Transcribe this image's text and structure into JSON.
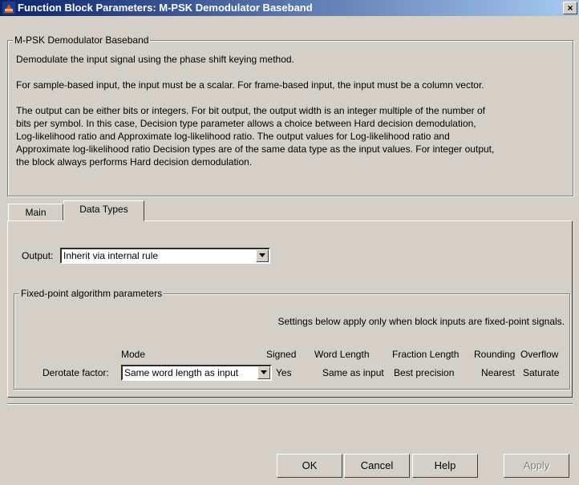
{
  "window": {
    "title": "Function Block Parameters: M-PSK Demodulator Baseband",
    "close_label": "×"
  },
  "block": {
    "group_title": "M-PSK Demodulator Baseband",
    "desc1": "Demodulate the input signal using the phase shift keying method.",
    "desc2": "For sample-based input, the input must be a scalar. For frame-based input, the input must be a column vector.",
    "desc3_lines": [
      "The output can be either bits or integers. For bit output, the output width is an integer multiple of the number of",
      "bits per symbol. In this case, Decision type parameter allows a choice between Hard decision demodulation,",
      "Log-likelihood ratio and Approximate log-likelihood ratio. The output values for Log-likelihood ratio and",
      "Approximate log-likelihood ratio Decision types are of the same data type as the input values. For integer output,",
      "the block always performs Hard decision demodulation."
    ]
  },
  "tabs": [
    "Main",
    "Data Types"
  ],
  "active_tab": "Data Types",
  "output": {
    "label": "Output:",
    "value": "Inherit via internal rule"
  },
  "fixed_point": {
    "group_title": "Fixed-point algorithm parameters",
    "note": "Settings below apply only when block inputs are fixed-point signals.",
    "headers": {
      "mode": "Mode",
      "signed": "Signed",
      "word_length": "Word Length",
      "fraction_length": "Fraction Length",
      "rounding": "Rounding",
      "overflow": "Overflow"
    },
    "row": {
      "label": "Derotate factor:",
      "mode": "Same word length as input",
      "signed": "Yes",
      "word_length": "Same as input",
      "fraction_length": "Best precision",
      "rounding": "Nearest",
      "overflow": "Saturate"
    }
  },
  "buttons": {
    "ok": "OK",
    "cancel": "Cancel",
    "help": "Help",
    "apply": "Apply"
  },
  "colors": {
    "face": "#d4d0c8",
    "title_start": "#0a246a",
    "title_end": "#a6caf0",
    "disabled_text": "#808080"
  }
}
